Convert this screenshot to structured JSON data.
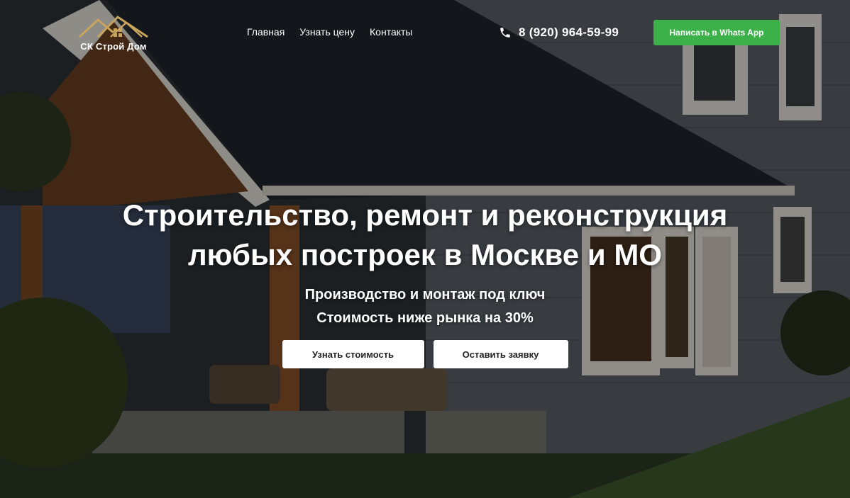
{
  "header": {
    "logo_text": "СК Строй Дом",
    "nav": [
      {
        "label": "Главная"
      },
      {
        "label": "Узнать цену"
      },
      {
        "label": "Контакты"
      }
    ],
    "phone": "8 (920) 964-59-99",
    "whatsapp_button": "Написать в Whats App"
  },
  "hero": {
    "title_line1": "Строительство, ремонт и реконструкция",
    "title_line2": "любых построек в Москве и МО",
    "subtitle_line1": "Производство и монтаж под ключ",
    "subtitle_line2": "Стоимость ниже рынка на 30%",
    "cta_price": "Узнать стоимость",
    "cta_request": "Оставить заявку"
  },
  "colors": {
    "accent_green": "#3cb14a",
    "logo_gold": "#c9a45c"
  },
  "icons": {
    "phone": "phone-icon",
    "logo": "house-roof-logo-icon"
  }
}
